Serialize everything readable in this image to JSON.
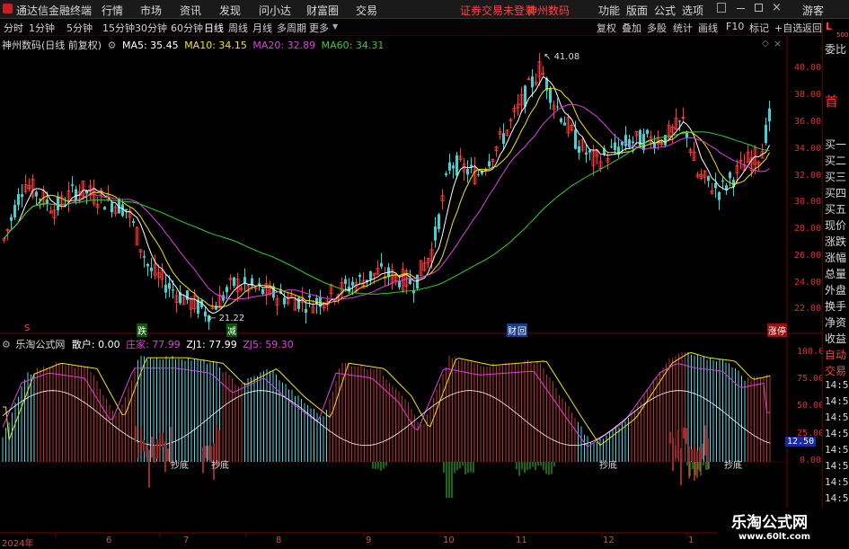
{
  "menubar": {
    "app_title": "通达信金融终端",
    "menus": [
      "行情",
      "市场",
      "资讯",
      "发现",
      "问小达",
      "财富圈",
      "交易"
    ],
    "login_notice": "证券交易未登录",
    "stock_name": "神州数码",
    "right_menus": [
      "功能",
      "版面",
      "公式",
      "选项"
    ],
    "guest": "游客"
  },
  "toolbar": {
    "periods": [
      "分时",
      "1分钟",
      "5分钟",
      "15分钟",
      "30分钟",
      "60分钟",
      "日线",
      "周线",
      "月线",
      "多周期",
      "更多"
    ],
    "active_period": "日线",
    "actions": [
      "复权",
      "叠加",
      "多股",
      "统计",
      "画线",
      "F10",
      "标记",
      "+自选",
      "返回"
    ]
  },
  "main_chart": {
    "title": "神州数码(日线 前复权)",
    "ma_labels": [
      {
        "text": "MA5: 35.45",
        "color": "#ffffff"
      },
      {
        "text": "MA10: 34.15",
        "color": "#f2e600"
      },
      {
        "text": "MA20: 32.89",
        "color": "#e040e0"
      },
      {
        "text": "MA60: 34.31",
        "color": "#30d030"
      }
    ],
    "high_label": "41.08",
    "low_label": "21.22",
    "y_ticks": [
      "40.00",
      "38.00",
      "36.00",
      "34.00",
      "32.00",
      "30.00",
      "28.00",
      "26.00",
      "24.00",
      "22.00"
    ],
    "markers": {
      "s": "S",
      "die": "跌",
      "jian": "减",
      "cai": "财",
      "hui": "回",
      "zhang": "涨",
      "ting": "停"
    }
  },
  "indicator": {
    "name": "乐淘公式网",
    "labels": [
      {
        "text": "散户: 0.00",
        "color": "#ffffff"
      },
      {
        "text": "庄家: 77.99",
        "color": "#e040e0"
      },
      {
        "text": "ZJ1: 77.99",
        "color": "#ffffff"
      },
      {
        "text": "ZJ5: 59.30",
        "color": "#e040e0"
      }
    ],
    "y_ticks": [
      "100.0",
      "75.00",
      "50.00",
      "25.00",
      "0.00"
    ],
    "current_value": "12.50",
    "signal_label": "抄底"
  },
  "x_axis": [
    "2024年",
    "6",
    "7",
    "8",
    "9",
    "10",
    "11",
    "12",
    "1"
  ],
  "right_panel": {
    "badge_l": "L",
    "badge_num": "500",
    "weibi": "委比",
    "shouxi": "首"
  },
  "right_panel_labels": [
    "买一",
    "买二",
    "买三",
    "买四",
    "买五",
    "现价",
    "涨跌",
    "涨幅",
    "总量",
    "外盘",
    "换手",
    "净资",
    "收益",
    "自动",
    "交易"
  ],
  "right_panel_times": [
    "14:56",
    "14:56",
    "14:56",
    "14:56",
    "14:56",
    "14:56",
    "14:56",
    "14:56"
  ],
  "watermark": {
    "title": "乐淘公式网",
    "url": "www.60lt.com"
  }
}
